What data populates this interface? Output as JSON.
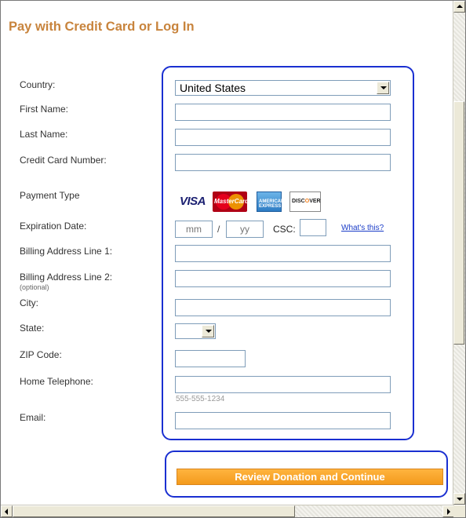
{
  "title": "Pay with Credit Card or Log In",
  "labels": {
    "country": "Country:",
    "first_name": "First Name:",
    "last_name": "Last Name:",
    "card_number": "Credit Card Number:",
    "payment_type": "Payment Type",
    "expiration": "Expiration Date:",
    "billing1": "Billing Address Line 1:",
    "billing2": "Billing Address Line 2:",
    "billing2_note": "(optional)",
    "city": "City:",
    "state": "State:",
    "zip": "ZIP Code:",
    "phone": "Home Telephone:",
    "email": "Email:"
  },
  "fields": {
    "country_value": "United States",
    "state_value": "",
    "exp_month_placeholder": "mm",
    "exp_year_placeholder": "yy",
    "slash": "/",
    "csc_label": "CSC:",
    "whats_this": "What's this?",
    "phone_hint": "555-555-1234"
  },
  "cards": {
    "visa": "VISA",
    "mastercard": "MasterCard",
    "amex": "AMERICAN EXPRESS",
    "discover_a": "DISC",
    "discover_b": "O",
    "discover_c": "VER",
    "icons": [
      "visa-icon",
      "mastercard-icon",
      "amex-icon",
      "discover-icon"
    ]
  },
  "review_button": "Review Donation and Continue",
  "colors": {
    "title": "#c8843d",
    "button": "#f39a1c",
    "highlight": "#1a2fd1"
  }
}
